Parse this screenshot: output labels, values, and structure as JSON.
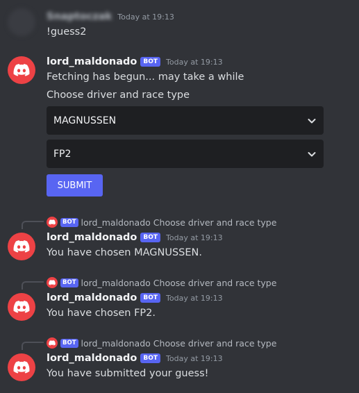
{
  "messages": [
    {
      "username": "Snaptoczak",
      "timestamp": "Today at 19:13",
      "text": "!guess2"
    },
    {
      "username": "lord_maldonado",
      "bot_label": "BOT",
      "timestamp": "Today at 19:13",
      "lines": [
        "Fetching has begun... may take a while",
        "Choose driver and race type"
      ],
      "selects": [
        {
          "value": "MAGNUSSEN"
        },
        {
          "value": "FP2"
        }
      ],
      "submit_label": "SUBMIT"
    },
    {
      "reply": {
        "bot_label": "BOT",
        "username": "lord_maldonado",
        "text": "Choose driver and race type"
      },
      "username": "lord_maldonado",
      "bot_label": "BOT",
      "timestamp": "Today at 19:13",
      "text": "You have chosen MAGNUSSEN."
    },
    {
      "reply": {
        "bot_label": "BOT",
        "username": "lord_maldonado",
        "text": "Choose driver and race type"
      },
      "username": "lord_maldonado",
      "bot_label": "BOT",
      "timestamp": "Today at 19:13",
      "text": "You have chosen FP2."
    },
    {
      "reply": {
        "bot_label": "BOT",
        "username": "lord_maldonado",
        "text": "Choose driver and race type"
      },
      "username": "lord_maldonado",
      "bot_label": "BOT",
      "timestamp": "Today at 19:13",
      "text": "You have submitted your guess!"
    }
  ],
  "icons": {
    "bot_avatar": "discord-logo-icon",
    "select_arrow": "chevron-down-icon"
  },
  "colors": {
    "background": "#313338",
    "avatar": "#ed4245",
    "bot_tag": "#5865f2",
    "submit": "#5865f2",
    "select_bg": "#1e1f22"
  }
}
